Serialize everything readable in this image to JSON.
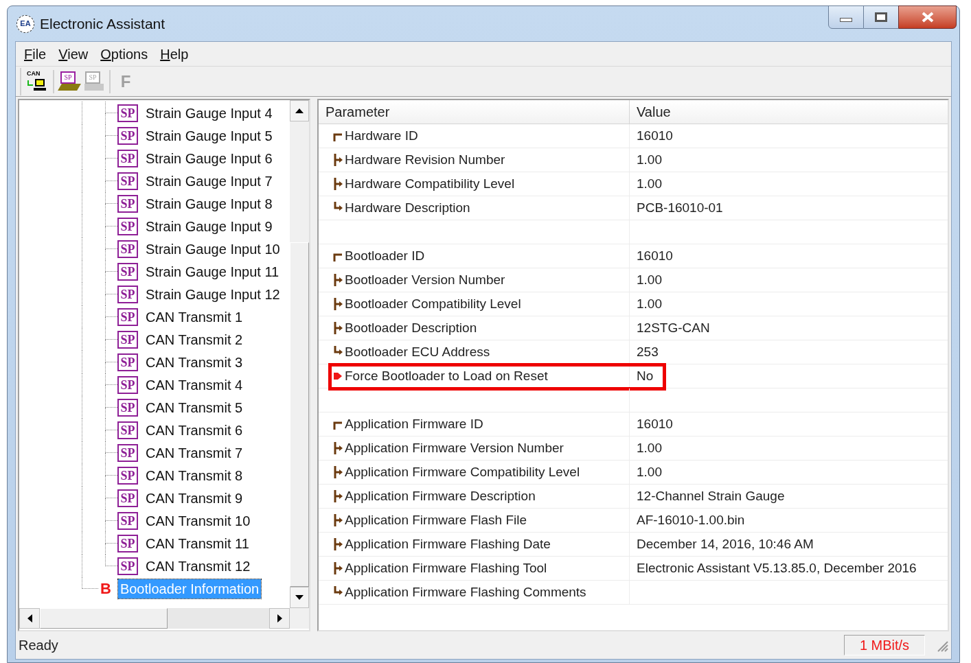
{
  "window": {
    "title": "Electronic Assistant",
    "logo": "EA"
  },
  "menu": [
    "File",
    "View",
    "Options",
    "Help"
  ],
  "toolbar": [
    {
      "kind": "can",
      "text": "CAN",
      "disabled": false
    },
    {
      "kind": "open",
      "text": "SP",
      "disabled": false
    },
    {
      "kind": "save",
      "text": "SP",
      "disabled": true
    },
    {
      "kind": "flash",
      "text": "F",
      "disabled": true
    }
  ],
  "tree": {
    "items": [
      {
        "children": [
          {
            "label": "Strain Gauge Input 4",
            "icon": "SP",
            "selected": false
          },
          {
            "label": "Strain Gauge Input 5",
            "icon": "SP",
            "selected": false
          },
          {
            "label": "Strain Gauge Input 6",
            "icon": "SP",
            "selected": false
          },
          {
            "label": "Strain Gauge Input 7",
            "icon": "SP",
            "selected": false
          },
          {
            "label": "Strain Gauge Input 8",
            "icon": "SP",
            "selected": false
          },
          {
            "label": "Strain Gauge Input 9",
            "icon": "SP",
            "selected": false
          },
          {
            "label": "Strain Gauge Input 10",
            "icon": "SP",
            "selected": false
          },
          {
            "label": "Strain Gauge Input 11",
            "icon": "SP",
            "selected": false
          },
          {
            "label": "Strain Gauge Input 12",
            "icon": "SP",
            "selected": false
          },
          {
            "label": "CAN Transmit 1",
            "icon": "SP",
            "selected": false
          },
          {
            "label": "CAN Transmit 2",
            "icon": "SP",
            "selected": false
          },
          {
            "label": "CAN Transmit 3",
            "icon": "SP",
            "selected": false
          },
          {
            "label": "CAN Transmit 4",
            "icon": "SP",
            "selected": false
          },
          {
            "label": "CAN Transmit 5",
            "icon": "SP",
            "selected": false
          },
          {
            "label": "CAN Transmit 6",
            "icon": "SP",
            "selected": false
          },
          {
            "label": "CAN Transmit 7",
            "icon": "SP",
            "selected": false
          },
          {
            "label": "CAN Transmit 8",
            "icon": "SP",
            "selected": false
          },
          {
            "label": "CAN Transmit 9",
            "icon": "SP",
            "selected": false
          },
          {
            "label": "CAN Transmit 10",
            "icon": "SP",
            "selected": false
          },
          {
            "label": "CAN Transmit 11",
            "icon": "SP",
            "selected": false
          },
          {
            "label": "CAN Transmit 12",
            "icon": "SP",
            "selected": false
          }
        ]
      },
      {
        "label": "Bootloader Information",
        "icon": "B",
        "selected": true
      }
    ]
  },
  "table": {
    "columns": [
      "Parameter",
      "Value"
    ],
    "rows": [
      {
        "kind": "first",
        "parameter": "Hardware ID",
        "value": "16010",
        "highlighted": false
      },
      {
        "kind": "middle",
        "parameter": "Hardware Revision Number",
        "value": "1.00",
        "highlighted": false
      },
      {
        "kind": "middle",
        "parameter": "Hardware Compatibility Level",
        "value": "1.00",
        "highlighted": false
      },
      {
        "kind": "last",
        "parameter": "Hardware Description",
        "value": "PCB-16010-01",
        "highlighted": false
      },
      {
        "kind": "blank"
      },
      {
        "kind": "first",
        "parameter": "Bootloader ID",
        "value": "16010",
        "highlighted": false
      },
      {
        "kind": "middle",
        "parameter": "Bootloader Version Number",
        "value": "1.00",
        "highlighted": false
      },
      {
        "kind": "middle",
        "parameter": "Bootloader Compatibility Level",
        "value": "1.00",
        "highlighted": false
      },
      {
        "kind": "middle",
        "parameter": "Bootloader Description",
        "value": "12STG-CAN",
        "highlighted": false
      },
      {
        "kind": "last",
        "parameter": "Bootloader ECU Address",
        "value": "253",
        "highlighted": false
      },
      {
        "kind": "flag",
        "parameter": "Force Bootloader to Load on Reset",
        "value": "No",
        "highlighted": true
      },
      {
        "kind": "blank"
      },
      {
        "kind": "first",
        "parameter": "Application Firmware ID",
        "value": "16010",
        "highlighted": false
      },
      {
        "kind": "middle",
        "parameter": "Application Firmware Version Number",
        "value": "1.00",
        "highlighted": false
      },
      {
        "kind": "middle",
        "parameter": "Application Firmware Compatibility Level",
        "value": "1.00",
        "highlighted": false
      },
      {
        "kind": "middle",
        "parameter": "Application Firmware Description",
        "value": "12-Channel Strain Gauge",
        "highlighted": false
      },
      {
        "kind": "middle",
        "parameter": "Application Firmware Flash File",
        "value": "AF-16010-1.00.bin",
        "highlighted": false
      },
      {
        "kind": "middle",
        "parameter": "Application Firmware Flashing Date",
        "value": "December 14, 2016, 10:46 AM",
        "highlighted": false
      },
      {
        "kind": "middle",
        "parameter": "Application Firmware Flashing Tool",
        "value": "Electronic Assistant V5.13.85.0, December 2016",
        "highlighted": false
      },
      {
        "kind": "last",
        "parameter": "Application Firmware Flashing Comments",
        "highlighted": false
      }
    ]
  },
  "status_bar": {
    "text": "Ready",
    "baud": "1 MBit/s"
  }
}
